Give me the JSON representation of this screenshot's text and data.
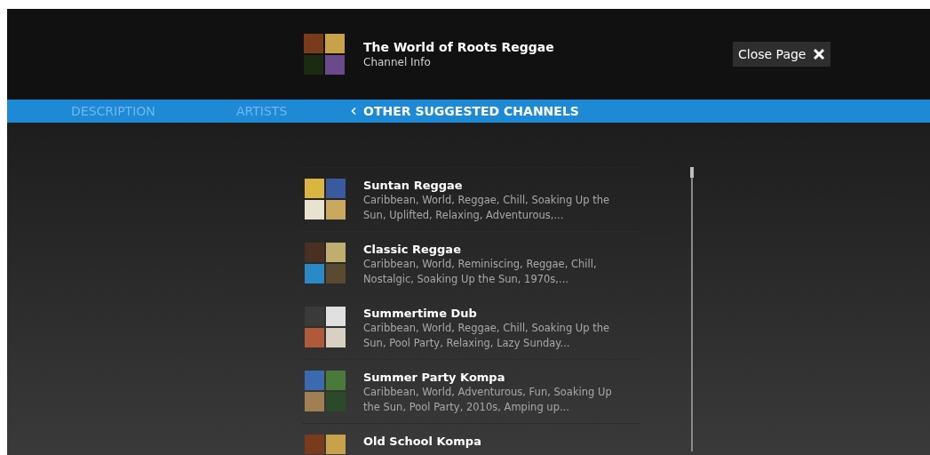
{
  "header": {
    "title": "The World of Roots Reggae",
    "subtitle": "Channel Info",
    "close_button": "Close Page"
  },
  "tabs": [
    {
      "label": "DESCRIPTION",
      "selected": false
    },
    {
      "label": "ARTISTS",
      "selected": false
    },
    {
      "label": "OTHER SUGGESTED CHANNELS",
      "selected": true
    }
  ],
  "channels": [
    {
      "name": "Suntan Reggae",
      "tags": "Caribbean, World, Reggae, Chill, Soaking Up the Sun, Uplifted, Relaxing, Adventurous,..."
    },
    {
      "name": "Classic Reggae",
      "tags": "Caribbean, World, Reminiscing, Reggae, Chill, Nostalgic, Soaking Up the Sun, 1970s,..."
    },
    {
      "name": "Summertime Dub",
      "tags": "Caribbean, World, Reggae, Chill, Soaking Up the Sun, Pool Party, Relaxing, Lazy Sunday..."
    },
    {
      "name": "Summer Party Kompa",
      "tags": "Caribbean, World, Adventurous, Fun, Soaking Up the Sun, Pool Party, 2010s, Amping up..."
    },
    {
      "name": "Old School Kompa"
    }
  ]
}
